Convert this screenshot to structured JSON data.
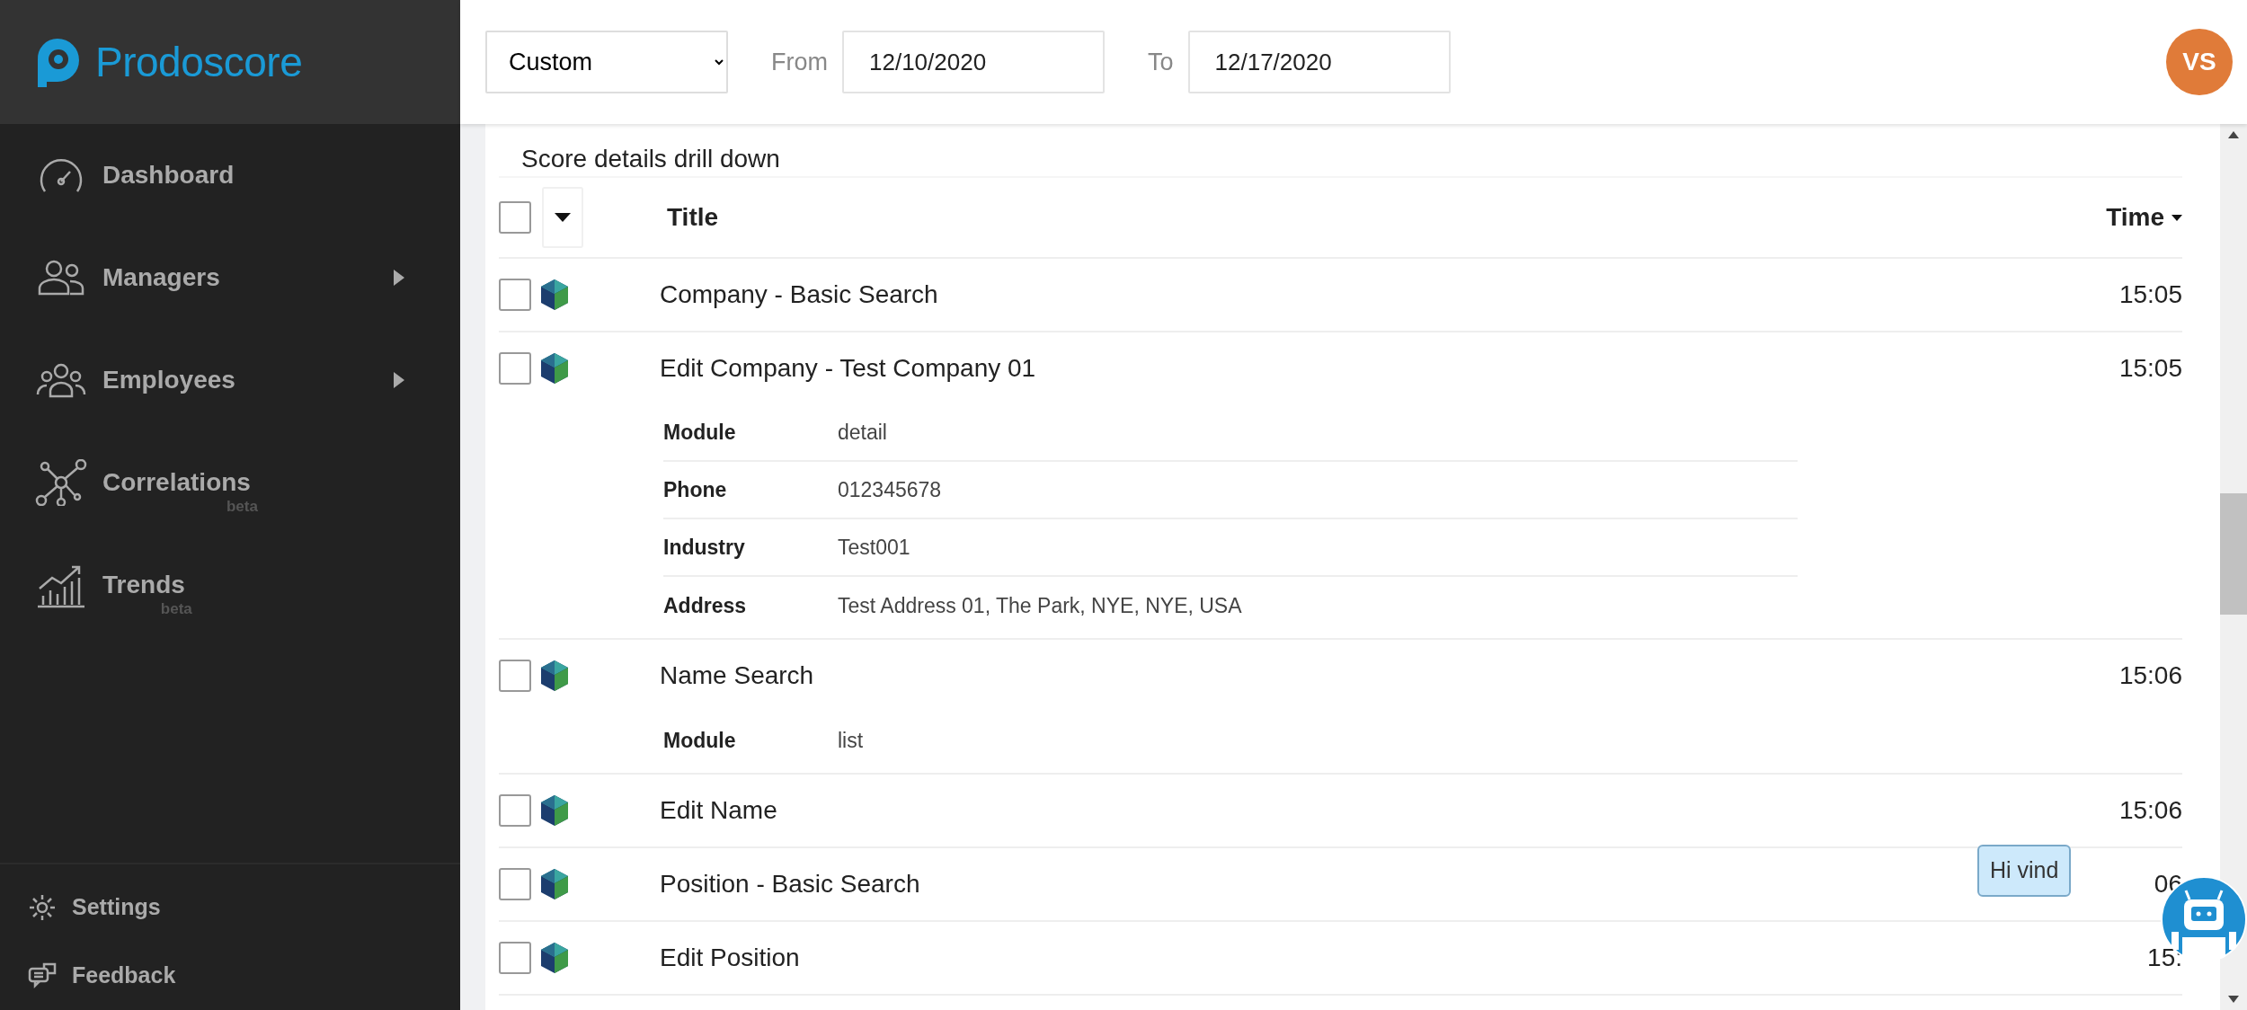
{
  "logo": {
    "text": "Prodoscore"
  },
  "nav": [
    {
      "label": "Dashboard",
      "submenu": false
    },
    {
      "label": "Managers",
      "submenu": true
    },
    {
      "label": "Employees",
      "submenu": true
    },
    {
      "label": "Correlations",
      "submenu": false,
      "tag": "beta"
    },
    {
      "label": "Trends",
      "submenu": false,
      "tag": "beta"
    }
  ],
  "footer_nav": [
    {
      "label": "Settings"
    },
    {
      "label": "Feedback"
    }
  ],
  "toolbar": {
    "range": "Custom",
    "from_label": "From",
    "from": "12/10/2020",
    "to_label": "To",
    "to": "12/17/2020",
    "avatar": "VS"
  },
  "panel": {
    "title": "Score details drill down",
    "header_checked": false,
    "columns": [
      "Title",
      "Time"
    ],
    "rows": [
      {
        "title": "Company - Basic Search",
        "time": "15:05",
        "checked": false
      },
      {
        "title": "Edit Company - Test Company 01",
        "time": "15:05",
        "checked": false,
        "details": [
          {
            "key": "Module",
            "value": "detail"
          },
          {
            "key": "Phone",
            "value": "012345678"
          },
          {
            "key": "Industry",
            "value": "Test001"
          },
          {
            "key": "Address",
            "value": "Test Address 01, The Park, NYE, NYE, USA"
          }
        ]
      },
      {
        "title": "Name Search",
        "time": "15:06",
        "checked": false,
        "details": [
          {
            "key": "Module",
            "value": "list"
          }
        ]
      },
      {
        "title": "Edit Name",
        "time": "15:06",
        "checked": false
      },
      {
        "title": "Position - Basic Search",
        "time": "06",
        "checked": false
      },
      {
        "title": "Edit Position",
        "time": "15:",
        "checked": false
      }
    ]
  },
  "chat": {
    "bubble": "Hi vind"
  }
}
